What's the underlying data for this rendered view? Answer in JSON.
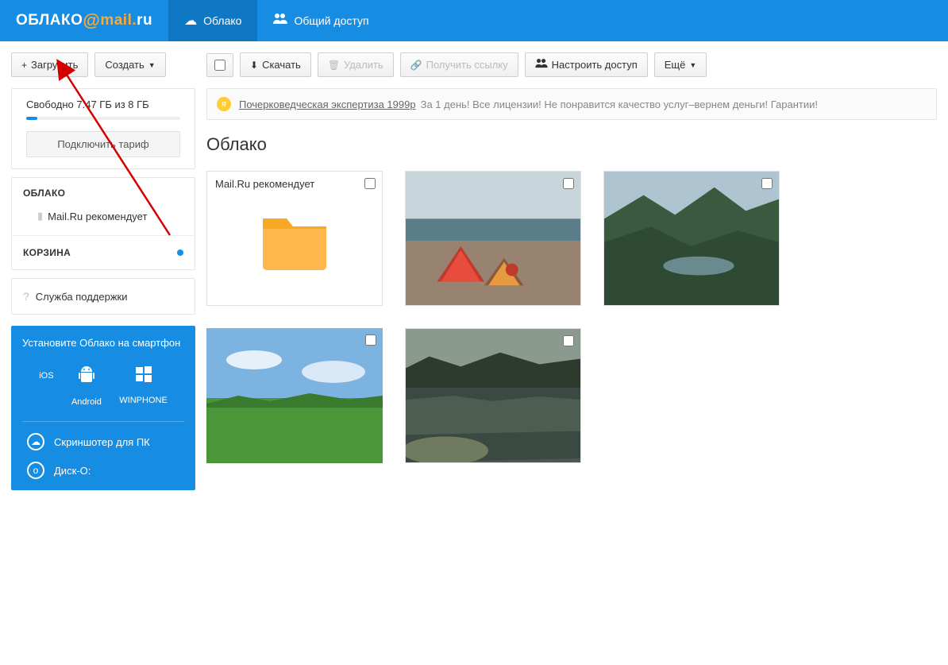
{
  "logo": {
    "cloud": "ОБЛАКО",
    "at": "@",
    "mail": "mail",
    "dot": ".",
    "ru": "ru"
  },
  "nav": {
    "cloud": "Облако",
    "shared": "Общий доступ"
  },
  "sidebar": {
    "upload": "Загрузить",
    "create": "Создать",
    "storage_text": "Свободно 7.47 ГБ из 8 ГБ",
    "connect_tariff": "Подключить тариф",
    "tree_cloud": "ОБЛАКО",
    "tree_recommend": "Mail.Ru рекомендует",
    "tree_trash": "КОРЗИНА",
    "support": "Служба поддержки",
    "promo_title": "Установите Облако на смартфон",
    "os": {
      "ios": "iOS",
      "android": "Android",
      "winphone": "WINPHONE"
    },
    "screenshoter": "Скриншотер для ПК",
    "disko": "Диск-О:"
  },
  "toolbar": {
    "download": "Скачать",
    "delete": "Удалить",
    "getlink": "Получить ссылку",
    "access": "Настроить доступ",
    "more": "Ещё"
  },
  "ad": {
    "link": "Почерковедческая экспертиза 1999р",
    "text": "За 1 день! Все лицензии! Не понравится качество услуг–вернем деньги! Гарантии!"
  },
  "page_title": "Облако",
  "files": {
    "folder_label": "Mail.Ru рекомендует"
  }
}
